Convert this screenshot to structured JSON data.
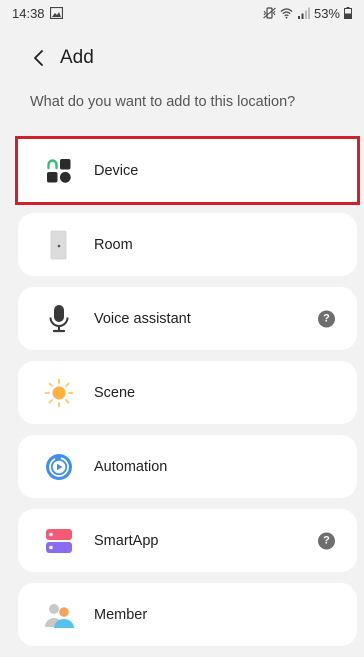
{
  "status_bar": {
    "time": "14:38",
    "battery": "53%"
  },
  "header": {
    "title": "Add"
  },
  "prompt": "What do you want to add to this location?",
  "items": [
    {
      "label": "Device",
      "icon": "device-grid-icon",
      "has_help": false,
      "highlighted": true
    },
    {
      "label": "Room",
      "icon": "door-icon",
      "has_help": false,
      "highlighted": false
    },
    {
      "label": "Voice assistant",
      "icon": "microphone-icon",
      "has_help": true,
      "highlighted": false
    },
    {
      "label": "Scene",
      "icon": "sun-icon",
      "has_help": false,
      "highlighted": false
    },
    {
      "label": "Automation",
      "icon": "automation-play-icon",
      "has_help": false,
      "highlighted": false
    },
    {
      "label": "SmartApp",
      "icon": "smartapp-stack-icon",
      "has_help": true,
      "highlighted": false
    },
    {
      "label": "Member",
      "icon": "people-icon",
      "has_help": false,
      "highlighted": false
    }
  ],
  "help_glyph": "?",
  "colors": {
    "highlight_border": "#d0202b",
    "background": "#f2f2f2",
    "card": "#ffffff"
  }
}
